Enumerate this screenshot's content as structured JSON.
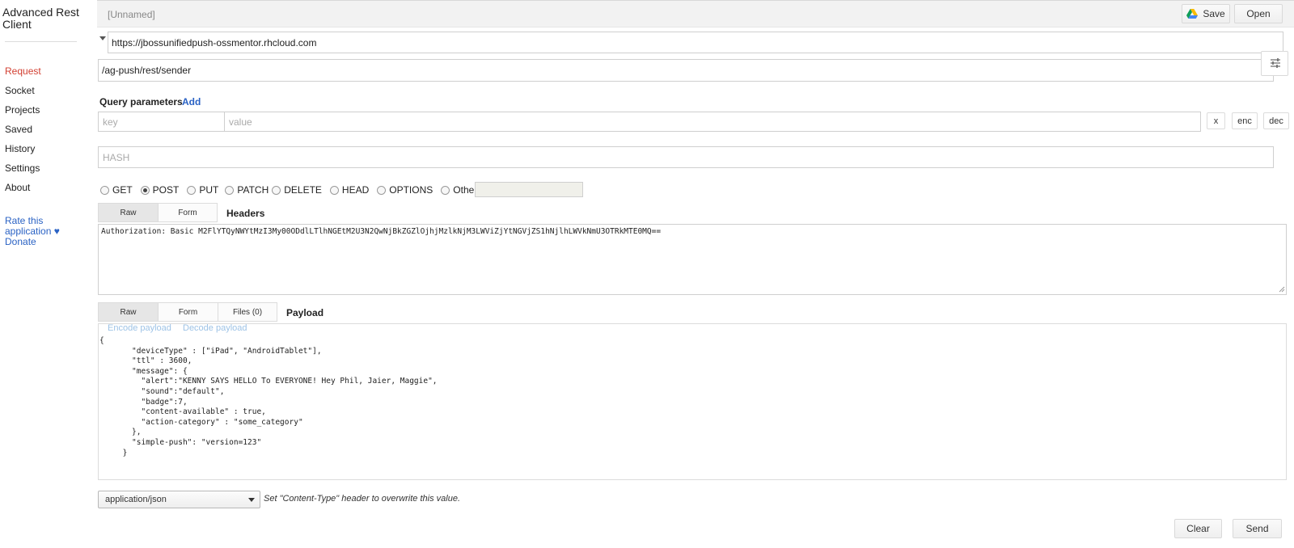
{
  "app": {
    "title_line1": "Advanced Rest",
    "title_line2": "Client"
  },
  "sidebar": {
    "items": [
      {
        "label": "Request",
        "active": true
      },
      {
        "label": "Socket"
      },
      {
        "label": "Projects"
      },
      {
        "label": "Saved"
      },
      {
        "label": "History"
      },
      {
        "label": "Settings"
      },
      {
        "label": "About"
      }
    ],
    "rate_line1": "Rate this",
    "rate_line2": "application ♥",
    "donate": "Donate"
  },
  "toolbar": {
    "project_name": "[Unnamed]",
    "save_label": "Save",
    "open_label": "Open"
  },
  "request": {
    "url": "https://jbossunifiedpush-ossmentor.rhcloud.com",
    "path": "/ag-push/rest/sender"
  },
  "query": {
    "label": "Query parameters",
    "add_label": "Add",
    "key_placeholder": "key",
    "value_placeholder": "value",
    "remove_label": "x",
    "enc_label": "enc",
    "dec_label": "dec",
    "hash_placeholder": "HASH"
  },
  "methods": {
    "options": [
      "GET",
      "POST",
      "PUT",
      "PATCH",
      "DELETE",
      "HEAD",
      "OPTIONS",
      "Other"
    ],
    "selected": "POST"
  },
  "headers": {
    "tabs": [
      "Raw",
      "Form"
    ],
    "label": "Headers",
    "value": "Authorization: Basic M2FlYTQyNWYtMzI3My00ODdlLTlhNGEtM2U3N2QwNjBkZGZlOjhjMzlkNjM3LWViZjYtNGVjZS1hNjlhLWVkNmU3OTRkMTE0MQ=="
  },
  "payload": {
    "tabs": [
      "Raw",
      "Form",
      "Files (0)"
    ],
    "label": "Payload",
    "encode_label": "Encode payload",
    "decode_label": "Decode payload",
    "body": "{\n       \"deviceType\" : [\"iPad\", \"AndroidTablet\"],\n       \"ttl\" : 3600,\n       \"message\": {\n         \"alert\":\"KENNY SAYS HELLO To EVERYONE! Hey Phil, Jaier, Maggie\",\n         \"sound\":\"default\",\n         \"badge\":7,\n         \"content-available\" : true,\n         \"action-category\" : \"some_category\"\n       },\n       \"simple-push\": \"version=123\"\n     }"
  },
  "content_type": {
    "selected": "application/json",
    "hint": "Set \"Content-Type\" header to overwrite this value."
  },
  "actions": {
    "clear_label": "Clear",
    "send_label": "Send"
  }
}
